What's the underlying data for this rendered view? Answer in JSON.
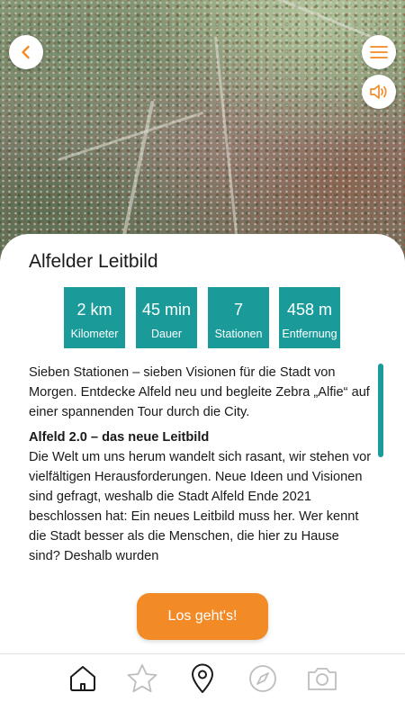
{
  "header": {
    "hero_image": "aerial-view-of-alfeld",
    "back_icon": "chevron-left-icon",
    "menu_icon": "hamburger-menu-icon",
    "sound_icon": "speaker-icon",
    "accent_color": "#f28a26"
  },
  "tour": {
    "title": "Alfelder Leitbild",
    "stats": [
      {
        "value": "2 km",
        "label": "Kilometer"
      },
      {
        "value": "45 min",
        "label": "Dauer"
      },
      {
        "value": "7",
        "label": "Stationen"
      },
      {
        "value": "458 m",
        "label": "Entfernung"
      }
    ],
    "stat_color": "#1a9b9a",
    "intro": "Sieben Stationen – sieben Visionen für die Stadt von Morgen. Entdecke Alfeld neu und begleite Zebra „Alfie“ auf einer spannenden Tour durch die City.",
    "section_heading": "Alfeld 2.0 – das neue Leitbild",
    "section_text": "Die Welt um uns herum wandelt sich rasant, wir stehen vor vielfältigen Herausforderungen. Neue Ideen und Visionen sind gefragt, weshalb die Stadt Alfeld Ende 2021 beschlossen hat: Ein neues Leitbild muss her. Wer kennt die Stadt besser als die Menschen, die hier zu Hause sind? Deshalb wurden",
    "cta_label": "Los geht's!",
    "cta_color": "#f28a26"
  },
  "bottom_nav": {
    "items": [
      {
        "icon": "home-icon",
        "active": true
      },
      {
        "icon": "star-icon",
        "active": false
      },
      {
        "icon": "map-pin-icon",
        "active": true
      },
      {
        "icon": "compass-icon",
        "active": false
      },
      {
        "icon": "camera-icon",
        "active": false
      }
    ]
  }
}
